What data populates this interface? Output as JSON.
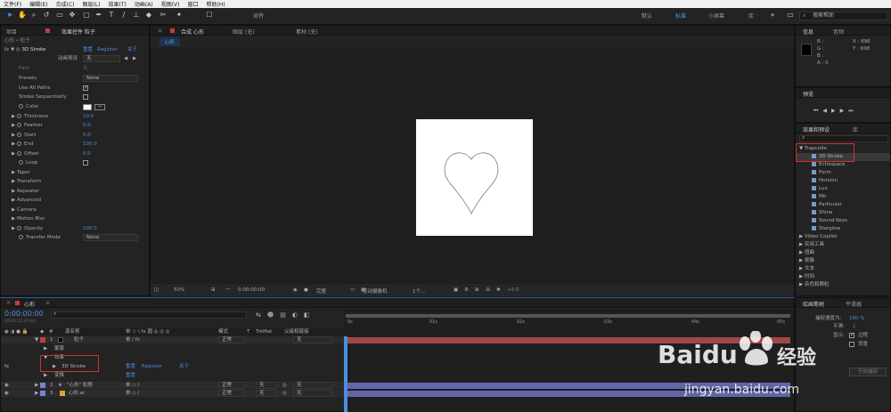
{
  "menu": [
    "文件(F)",
    "编辑(E)",
    "合成(C)",
    "图层(L)",
    "效果(T)",
    "动画(A)",
    "视图(V)",
    "窗口",
    "帮助(H)"
  ],
  "toolbar": {
    "snap_label": "对齐",
    "workspaces": [
      "默认",
      "标准",
      "小屏幕",
      "库"
    ],
    "active_workspace": "标准",
    "search_placeholder": "搜索帮助"
  },
  "project_panel": {
    "tab_project": "项目",
    "tab_effect_controls": "效果控件 粒子",
    "breadcrumb": "心形 • 粒子",
    "effect_name": "3D Stroke",
    "effect_links": [
      "重置",
      "Register",
      "关于"
    ],
    "animation_preset_label": "动画预设",
    "animation_preset_value": "无",
    "path_label": "Path",
    "path_value": "无",
    "presets_label": "Presets",
    "presets_value": "None",
    "use_all_paths": "Use All Paths",
    "stroke_sequentially": "Stroke Sequentially",
    "color_label": "Color",
    "thickness": {
      "label": "Thickness",
      "value": "10.0"
    },
    "feather": {
      "label": "Feather",
      "value": "0.0"
    },
    "start": {
      "label": "Start",
      "value": "0.0"
    },
    "end": {
      "label": "End",
      "value": "100.0"
    },
    "offset": {
      "label": "Offset",
      "value": "0.0"
    },
    "loop_label": "Loop",
    "groups": [
      "Taper",
      "Transform",
      "Repeater",
      "Advanced",
      "Camera",
      "Motion Blur"
    ],
    "opacity": {
      "label": "Opacity",
      "value": "100.0"
    },
    "transfer_mode": {
      "label": "Transfer Mode",
      "value": "None"
    }
  },
  "composition": {
    "tab_comp": "合成 心形",
    "tab_layer": "图层 (无)",
    "tab_footage": "素材 (无)",
    "sub_tab": "心形",
    "zoom": "50%",
    "timecode": "0:00:00:00",
    "resolution": "完整",
    "camera": "活动摄像机",
    "views": "1个...",
    "offset": "+0.0"
  },
  "info_panel": {
    "tab_info": "信息",
    "tab_audio": "音频",
    "r": "R :",
    "g": "G :",
    "b": "B :",
    "a": "A : 0",
    "x": "X : 896",
    "y": "Y : 698"
  },
  "preview_panel": {
    "tab": "预览"
  },
  "effects_panel": {
    "tab": "效果和预设",
    "tab2": "库",
    "category": "Trapcode",
    "items": [
      "3D Stroke",
      "Echospace",
      "Form",
      "Horizon",
      "Lux",
      "Mir",
      "Particular",
      "Shine",
      "Sound Keys",
      "Starglow"
    ],
    "other_categories": [
      "Video Copilot",
      "实用工具",
      "扭曲",
      "抠像",
      "文本",
      "时间",
      "杂色和颗粒"
    ]
  },
  "timeline": {
    "tab": "心形",
    "timecode": "0:00:00:00",
    "timecode_sub": "00000 (25.00 fps)",
    "columns": {
      "name": "源名称",
      "switches": "单 ☆ \\ fx 圆 ◎ ◎ ◎",
      "mode": "模式",
      "t": "T",
      "trkmat": "TrkMat",
      "parent": "父级和链接"
    },
    "layers": [
      {
        "num": "1",
        "name": "粒子",
        "mode": "正常",
        "parent": "无",
        "color": "#c83c3c"
      },
      {
        "num": "2",
        "name": "\"心形\" 轮廓",
        "mode": "正常",
        "trkmat": "无",
        "parent": "无",
        "color": "#7b80d8"
      },
      {
        "num": "3",
        "name": "心形.ai",
        "mode": "正常",
        "trkmat": "无",
        "parent": "无",
        "color": "#7b80d8"
      }
    ],
    "sub_mask": "蒙版",
    "sub_effects": "效果",
    "sub_stroke": "3D Stroke",
    "sub_stroke_links": [
      "重置",
      "Register",
      "关于"
    ],
    "sub_transform": "变换",
    "ruler_labels": [
      "0s",
      "01s",
      "02s",
      "03s",
      "04s",
      "05s"
    ]
  },
  "paint_panel": {
    "tab": "绘画笔刷",
    "tab2": "平滑器",
    "capture_speed": "捕捉速度为:",
    "capture_value": "100 %",
    "smooth": "平滑:",
    "smooth_value": "1",
    "show": "显示:",
    "show_opt1": "过程",
    "show_opt2": "背景",
    "start_btn": "开始捕捉"
  },
  "watermark": {
    "brand": "Baidu",
    "brand_cn": "经验",
    "url": "jingyan.baidu.com"
  }
}
